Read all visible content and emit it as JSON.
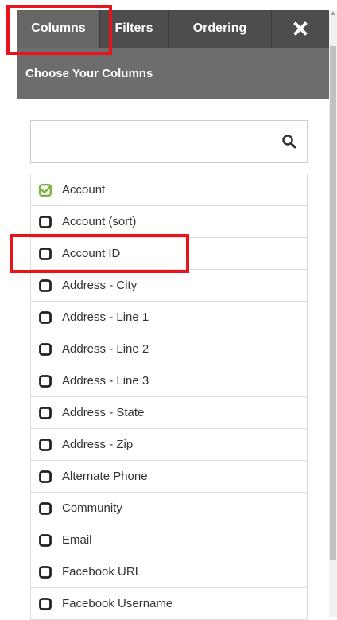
{
  "tabs": [
    {
      "label": "Columns",
      "active": true
    },
    {
      "label": "Filters",
      "active": false
    },
    {
      "label": "Ordering",
      "active": false
    }
  ],
  "close_icon": "close-icon",
  "header": {
    "title": "Choose Your Columns"
  },
  "search": {
    "value": "",
    "placeholder": "",
    "icon": "search-icon"
  },
  "columns": [
    {
      "label": "Account",
      "checked": true
    },
    {
      "label": "Account (sort)",
      "checked": false
    },
    {
      "label": "Account ID",
      "checked": false
    },
    {
      "label": "Address - City",
      "checked": false
    },
    {
      "label": "Address - Line 1",
      "checked": false
    },
    {
      "label": "Address - Line 2",
      "checked": false
    },
    {
      "label": "Address - Line 3",
      "checked": false
    },
    {
      "label": "Address - State",
      "checked": false
    },
    {
      "label": "Address - Zip",
      "checked": false
    },
    {
      "label": "Alternate Phone",
      "checked": false
    },
    {
      "label": "Community",
      "checked": false
    },
    {
      "label": "Email",
      "checked": false
    },
    {
      "label": "Facebook URL",
      "checked": false
    },
    {
      "label": "Facebook Username",
      "checked": false
    }
  ],
  "colors": {
    "tab_bar": "#4d4d4d",
    "tab_active": "#666666",
    "header": "#6d6d6d",
    "checked": "#7cb342",
    "highlight": "#e8141a"
  }
}
